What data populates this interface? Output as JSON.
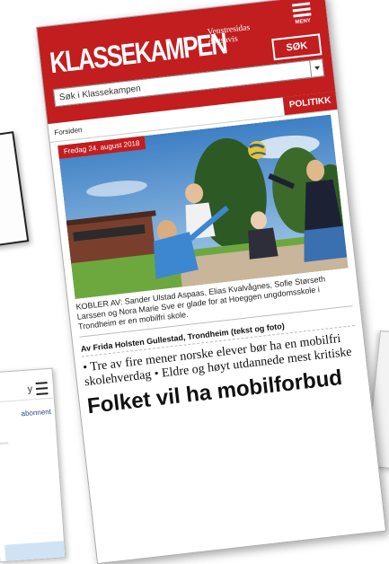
{
  "background": {
    "left_card_y_text": "y",
    "left_card_subscribe": "abonnent"
  },
  "masthead": {
    "logo": "KLASSEKAMPEN",
    "tagline": "Venstresidas dagsavis",
    "menu_label": "MENY",
    "search_button": "SØK",
    "search_placeholder": "Søk i Klassekampen",
    "brand_color": "#c21d1f"
  },
  "breadcrumb": {
    "home": "Forsiden",
    "section": "POLITIKK"
  },
  "article": {
    "date": "Fredag 24. august 2018",
    "caption": "KOBLER AV: Sander Ulstad Aspaas, Elias Kvalvågnes, Sofie Størseth Larssen og Nora Marie Sve er glade for at Hoeggen ungdomsskole i Trondheim er en mobilfri skole.",
    "byline": "Av Frida Holsten Gullestad, Trondheim (tekst og foto)",
    "summary": "• Tre av fire mener norske elever bør ha en mobilfri skolehverdag • Eldre og høyt utdannede mest kritiske",
    "headline": "Folket vil ha mobilforbud"
  }
}
